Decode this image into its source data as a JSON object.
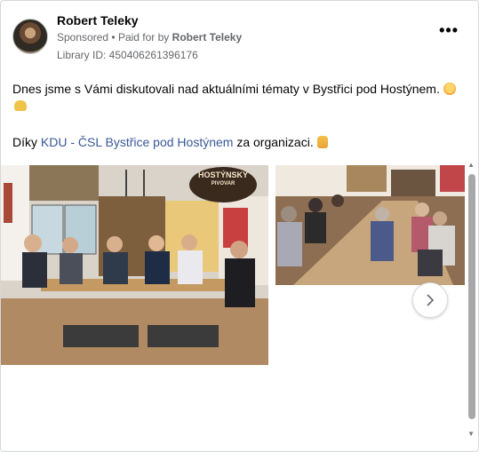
{
  "post": {
    "author": "Robert Teleky",
    "sponsored_label": "Sponsored",
    "paid_for_prefix": "Paid for by",
    "paid_for_name": "Robert Teleky",
    "library_id": "Library ID: 450406261396176",
    "more_icon": "more-options-icon",
    "text_line1": "Dnes jsme s Vámi diskutovali nad aktuálními tématy v Bystřici pod Hostýnem.",
    "text_line2_prefix": "Díky",
    "text_line2_link": "KDU - ČSL Bystřice pod Hostýnem",
    "text_line2_suffix": "za organizaci.",
    "photo_sign_line1": "HOSTÝNSKÝ",
    "photo_sign_line2": "PIVOVAR",
    "next_icon": "chevron-right-icon"
  },
  "colors": {
    "link": "#385898",
    "secondary_text": "#65676b",
    "primary_text": "#050505"
  }
}
